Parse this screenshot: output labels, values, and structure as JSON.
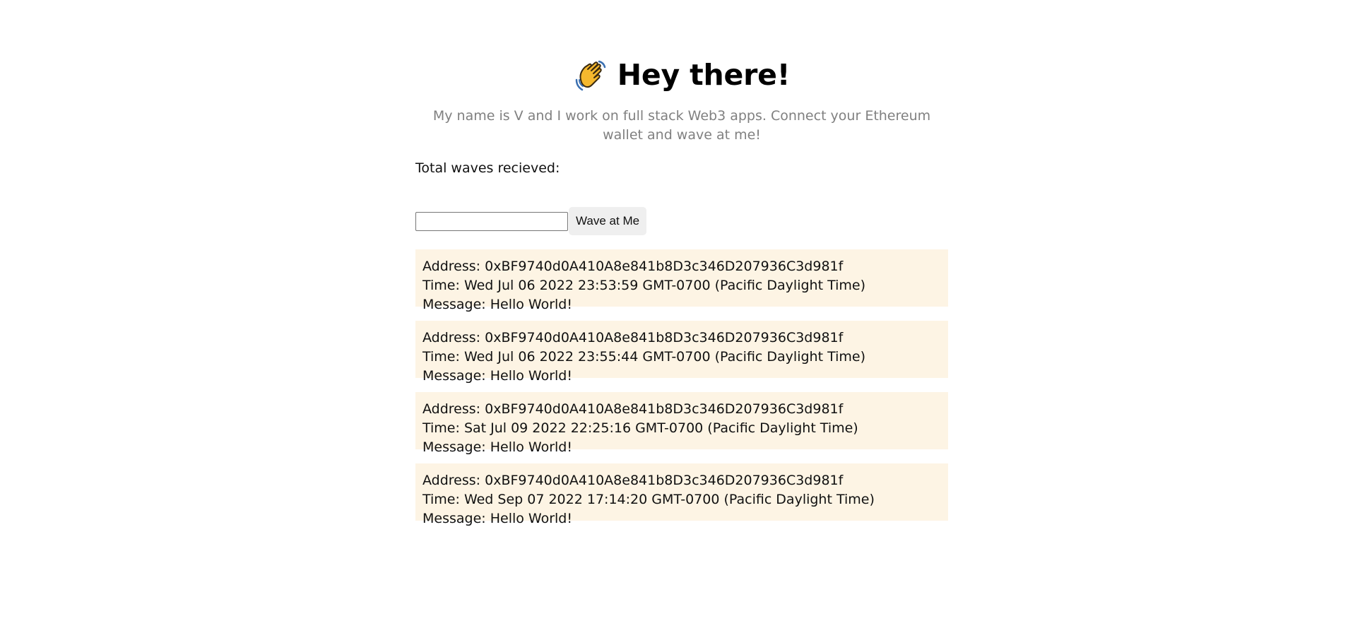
{
  "header": {
    "emoji_icon": "waving-hand-icon",
    "title": "Hey there!"
  },
  "bio": {
    "text": "My name is V and I work on full stack Web3 apps. Connect your Ethereum wallet and wave at me!"
  },
  "stats": {
    "total_label": "Total waves recieved:"
  },
  "form": {
    "message_value": "",
    "message_placeholder": "",
    "wave_button_label": "Wave at Me"
  },
  "waves": [
    {
      "address": "Address: 0xBF9740d0A410A8e841b8D3c346D207936C3d981f",
      "time": "Time: Wed Jul 06 2022 23:53:59 GMT-0700 (Pacific Daylight Time)",
      "message": "Message: Hello World!"
    },
    {
      "address": "Address: 0xBF9740d0A410A8e841b8D3c346D207936C3d981f",
      "time": "Time: Wed Jul 06 2022 23:55:44 GMT-0700 (Pacific Daylight Time)",
      "message": "Message: Hello World!"
    },
    {
      "address": "Address: 0xBF9740d0A410A8e841b8D3c346D207936C3d981f",
      "time": "Time: Sat Jul 09 2022 22:25:16 GMT-0700 (Pacific Daylight Time)",
      "message": "Message: Hello World!"
    },
    {
      "address": "Address: 0xBF9740d0A410A8e841b8D3c346D207936C3d981f",
      "time": "Time: Wed Sep 07 2022 17:14:20 GMT-0700 (Pacific Daylight Time)",
      "message": "Message: Hello World!"
    }
  ],
  "colors": {
    "card_background": "#fdf4e4",
    "bio_text": "#808080",
    "button_background": "#efefef"
  }
}
